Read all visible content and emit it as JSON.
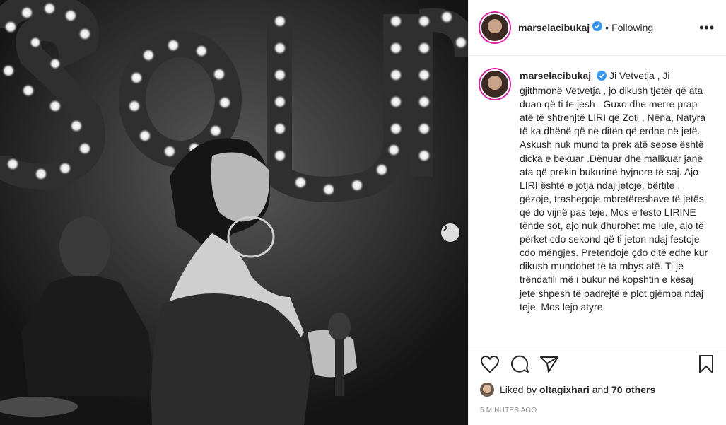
{
  "post": {
    "username": "marselacibukaj",
    "follow_state": "Following",
    "separator": "•",
    "more_label": "•••"
  },
  "caption": {
    "username": "marselacibukaj",
    "text": "Ji Vetvetja , Ji gjithmonë Vetvetja , jo dikush tjetër që ata duan që ti te jesh . Guxo dhe merre prap atë të shtrenjtë LIRI që Zoti , Nëna, Natyra të ka dhënë që në ditën që erdhe në jetë. Askush nuk mund ta prek atë sepse është dicka e bekuar .Dënuar dhe mallkuar janë ata që prekin bukurinë hyjnore të saj. Ajo LIRI është e jotja ndaj jetoje, bërtite , gëzoje, trashëgoje mbretëreshave të jetës që do vijnë pas teje. Mos e festo LIRINE tënde sot, ajo nuk dhurohet me lule, ajo të përket cdo sekond që ti jeton ndaj festoje cdo mëngjes. Pretendoje çdo ditë edhe kur dikush mundohet të ta mbys atë. Ti je trëndafili më i bukur në kopshtin e kësaj jete shpesh të padrejtë e plot gjëmba ndaj teje. Mos lejo atyre"
  },
  "likes": {
    "prefix": "Liked by",
    "user": "oltagixhari",
    "middle": "and",
    "others": "70 others"
  },
  "timestamp": "5 MINUTES AGO",
  "icons": {
    "verified": "verified-badge-icon",
    "like": "heart-icon",
    "comment": "comment-icon",
    "share": "send-icon",
    "save": "bookmark-icon",
    "next": "chevron-right-icon"
  },
  "colors": {
    "verified": "#3897f0",
    "story_ring": "#d6249f",
    "timestamp": "#8e8e8e"
  }
}
